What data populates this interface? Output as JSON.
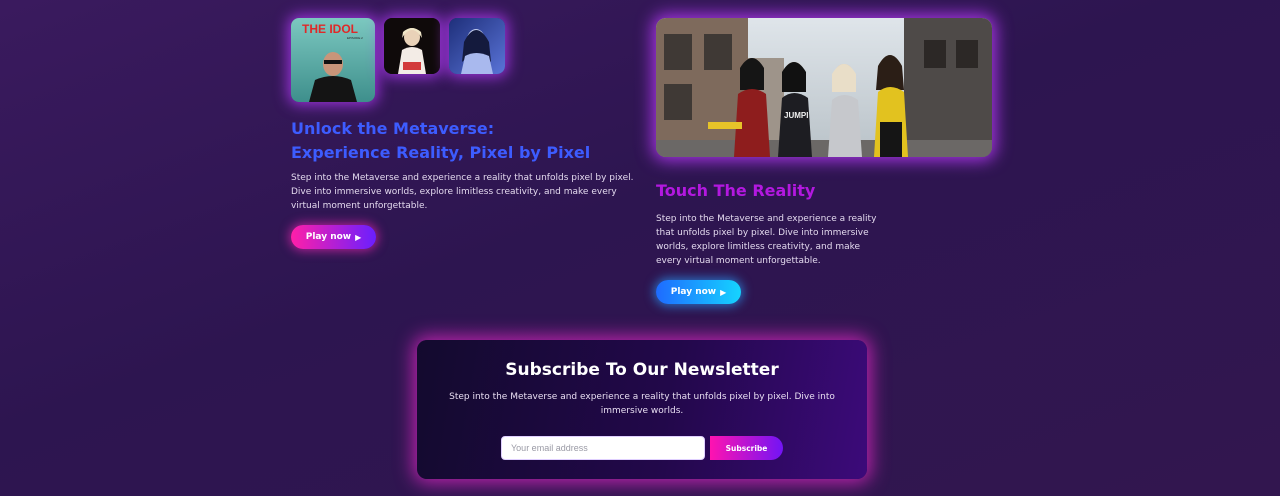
{
  "gallery": {
    "album_title": "THE IDOL",
    "album_subtitle": "EPISODE 2"
  },
  "hero": {
    "shirt_text": "JUMPI"
  },
  "left_feature": {
    "title_line1": "Unlock the Metaverse:",
    "title_line2": "Experience Reality, Pixel by Pixel",
    "body": "Step into the Metaverse and experience a reality that unfolds pixel by pixel. Dive into immersive worlds, explore limitless creativity, and make every virtual moment unforgettable.",
    "button_label": "Play now",
    "button_icon": "play-icon"
  },
  "right_feature": {
    "title": "Touch The Reality",
    "body": "Step into the Metaverse and experience a reality that unfolds pixel by pixel. Dive into immersive worlds, explore limitless creativity, and make every virtual moment unforgettable.",
    "button_label": "Play now",
    "button_icon": "play-icon"
  },
  "newsletter": {
    "title": "Subscribe To Our Newsletter",
    "text": "Step into the Metaverse and experience a reality that unfolds pixel by pixel. Dive into immersive worlds.",
    "email_placeholder": "Your email address",
    "email_value": "",
    "subscribe_label": "Subscribe"
  },
  "colors": {
    "left_title": "#3d5cff",
    "right_title": "#b318e0",
    "pink_accent": "#ff1fa8",
    "cyan_accent": "#15d4ff",
    "purple_bg": "#2d1550"
  }
}
